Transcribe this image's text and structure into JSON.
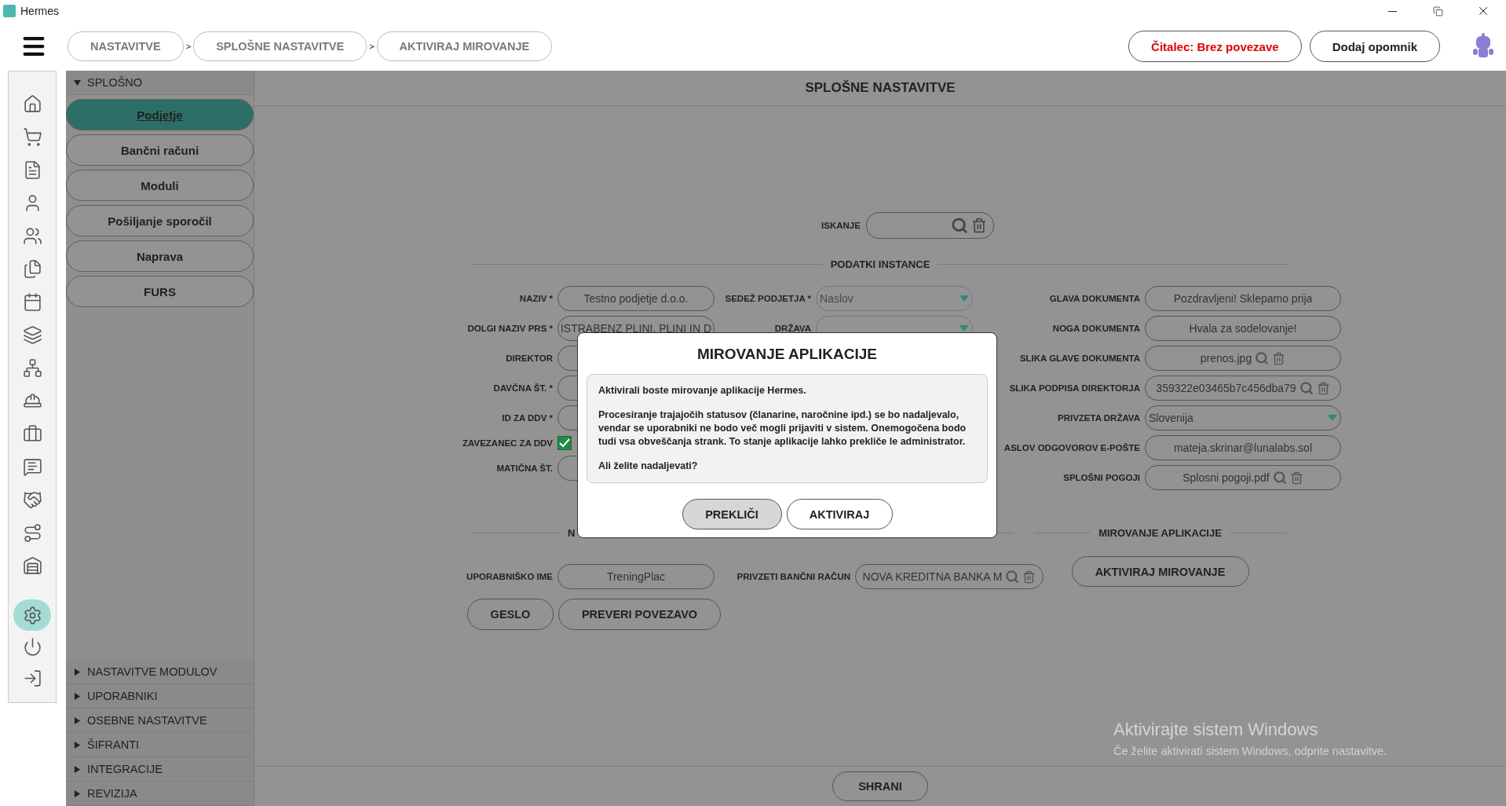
{
  "window": {
    "title": "Hermes"
  },
  "header": {
    "breadcrumbs": [
      {
        "label": "NASTAVITVE"
      },
      {
        "separator": ">",
        "label": "SPLOŠNE NASTAVITVE"
      },
      {
        "separator": ">",
        "label": "AKTIVIRAJ MIROVANJE"
      }
    ],
    "actions": [
      {
        "label": "Čitalec: Brez povezave",
        "kind": "alert"
      },
      {
        "label": "Dodaj opomnik",
        "kind": "normal"
      }
    ]
  },
  "rail": {
    "top": [
      {
        "selected": false
      },
      {
        "selected": false
      },
      {
        "selected": false
      },
      {
        "selected": false
      },
      {
        "selected": false
      },
      {
        "selected": false
      },
      {
        "selected": false
      },
      {
        "selected": false
      },
      {
        "selected": false
      },
      {
        "selected": false
      },
      {
        "selected": false
      },
      {
        "selected": false
      },
      {
        "selected": false
      },
      {
        "selected": false
      },
      {
        "selected": false
      }
    ],
    "bottom": [
      {
        "selected": true
      },
      {
        "selected": false
      },
      {
        "selected": false
      }
    ]
  },
  "sidebar": {
    "sections": [
      {
        "title": "SPLOŠNO",
        "expanded": true,
        "items": [
          {
            "label": "Podjetje",
            "selected": true
          },
          {
            "label": "Bančni računi",
            "selected": false
          },
          {
            "label": "Moduli",
            "selected": false
          },
          {
            "label": "Pošiljanje sporočil",
            "selected": false
          },
          {
            "label": "Naprava",
            "selected": false
          },
          {
            "label": "FURS",
            "selected": false
          }
        ]
      },
      {
        "title": "NASTAVITVE MODULOV",
        "expanded": false
      },
      {
        "title": "UPORABNIKI",
        "expanded": false
      },
      {
        "title": "OSEBNE NASTAVITVE",
        "expanded": false
      },
      {
        "title": "ŠIFRANTI",
        "expanded": false
      },
      {
        "title": "INTEGRACIJE",
        "expanded": false
      },
      {
        "title": "REVIZIJA",
        "expanded": false
      }
    ]
  },
  "main": {
    "title": "SPLOŠNE NASTAVITVE",
    "search": {
      "label": "ISKANJE"
    },
    "instance": {
      "title": "PODATKI INSTANCE",
      "columns": [
        [
          {
            "label": "NAZIV *",
            "kind": "text",
            "value": "Testno podjetje d.o.o."
          },
          {
            "label": "DOLGI NAZIV PRS *",
            "kind": "text",
            "value": "ISTRABENZ PLINI, PLINI IN D"
          },
          {
            "label": "DIREKTOR",
            "kind": "text"
          },
          {
            "label": "DAVČNA ŠT. *",
            "kind": "text"
          },
          {
            "label": "ID ZA DDV *",
            "kind": "text"
          },
          {
            "label": "ZAVEZANEC ZA DDV",
            "kind": "checkbox",
            "checked": true
          },
          {
            "label": "MATIČNA ŠT.",
            "kind": "text"
          }
        ],
        [
          {
            "label": "SEDEŽ PODJETJA *",
            "kind": "select",
            "placeholder": "Naslov"
          },
          {
            "label": "DRŽAVA",
            "kind": "select"
          }
        ],
        [
          {
            "label": "GLAVA DOKUMENTA",
            "kind": "text",
            "value": "Pozdravljeni! Sklepamo prija"
          },
          {
            "label": "NOGA DOKUMENTA",
            "kind": "text",
            "value": "Hvala za sodelovanje!"
          },
          {
            "label": "SLIKA GLAVE DOKUMENTA",
            "kind": "file",
            "value": "prenos.jpg"
          },
          {
            "label": "SLIKA PODPISA DIREKTORJA",
            "kind": "file",
            "value": "359322e03465b7c456dba79"
          },
          {
            "label": "PRIVZETA DRŽAVA",
            "kind": "select",
            "value": "Slovenija"
          },
          {
            "label": "ASLOV ODGOVOROV E-POŠTE",
            "kind": "text",
            "value": "mateja.skrinar@lunalabs.sol"
          },
          {
            "label": "SPLOŠNI POGOJI",
            "kind": "file",
            "value": "Splosni pogoji.pdf"
          }
        ]
      ]
    },
    "connection": {
      "title": "N",
      "fields": [
        {
          "label": "UPORABNIŠKO IME",
          "kind": "text",
          "value": "TreningPlac"
        },
        {
          "label": "PRIVZETI BANČNI RAČUN",
          "kind": "file",
          "value": "NOVA KREDITNA BANKA M"
        }
      ],
      "buttons": [
        "GESLO",
        "PREVERI POVEZAVO"
      ]
    },
    "dormancy": {
      "title": "MIROVANJE APLIKACIJE",
      "button": "AKTIVIRAJ MIROVANJE"
    },
    "footer": {
      "button": "SHRANI"
    }
  },
  "dialog": {
    "title": "MIROVANJE APLIKACIJE",
    "paragraphs": [
      "Aktivirali boste mirovanje aplikacije Hermes.",
      "Procesiranje trajajočih statusov (članarine, naročnine ipd.) se bo nadaljevalo, vendar se uporabniki ne bodo več mogli prijaviti v sistem. Onemogočena bodo tudi vsa obveščanja strank. To stanje aplikacije lahko prekliče le administrator.",
      "Ali želite nadaljevati?"
    ],
    "buttons": [
      {
        "label": "PREKLIČI",
        "selected": true
      },
      {
        "label": "AKTIVIRAJ",
        "selected": false
      }
    ]
  },
  "os_notice": {
    "title": "Aktivirajte sistem Windows",
    "text": "Če želite aktivirati sistem Windows, odprite nastavitve."
  }
}
